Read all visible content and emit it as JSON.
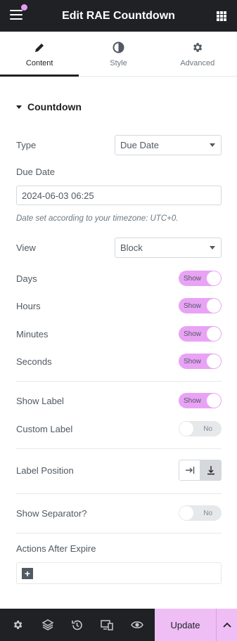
{
  "header": {
    "title": "Edit RAE Countdown"
  },
  "tabs": [
    {
      "label": "Content",
      "icon": "pencil-icon",
      "active": true
    },
    {
      "label": "Style",
      "icon": "contrast-icon",
      "active": false
    },
    {
      "label": "Advanced",
      "icon": "gear-icon",
      "active": false
    }
  ],
  "section": {
    "title": "Countdown"
  },
  "fields": {
    "type": {
      "label": "Type",
      "value": "Due Date"
    },
    "due_date": {
      "label": "Due Date",
      "value": "2024-06-03 06:25",
      "note": "Date set according to your timezone: UTC+0."
    },
    "view": {
      "label": "View",
      "value": "Block"
    },
    "days": {
      "label": "Days",
      "state": "Show"
    },
    "hours": {
      "label": "Hours",
      "state": "Show"
    },
    "minutes": {
      "label": "Minutes",
      "state": "Show"
    },
    "seconds": {
      "label": "Seconds",
      "state": "Show"
    },
    "show_label": {
      "label": "Show Label",
      "state": "Show"
    },
    "custom_label": {
      "label": "Custom Label",
      "state": "No"
    },
    "label_position": {
      "label": "Label Position"
    },
    "show_separator": {
      "label": "Show Separator?",
      "state": "No"
    },
    "actions_after_expire": {
      "label": "Actions After Expire"
    }
  },
  "footer": {
    "update_label": "Update"
  },
  "colors": {
    "accent": "#eebef5",
    "toggle_on": "#e9a3f5",
    "dark": "#1f2124"
  }
}
